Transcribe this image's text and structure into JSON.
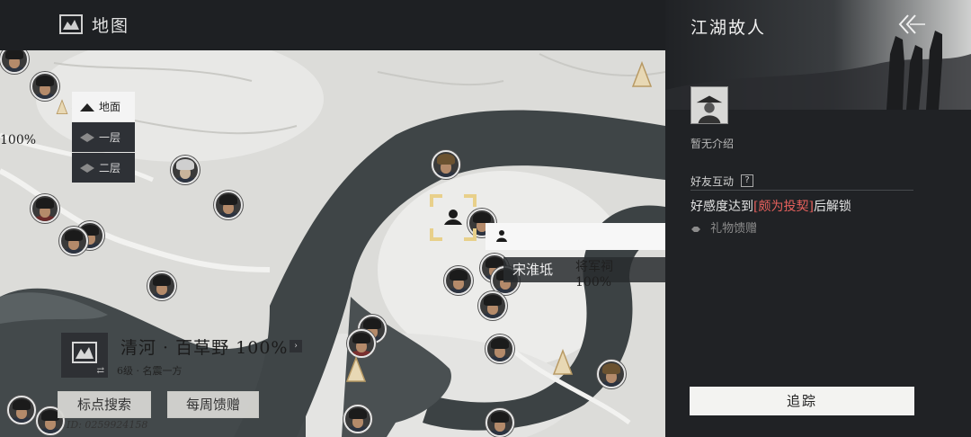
{
  "topbar": {
    "title": "地图",
    "map_icon": "map-icon"
  },
  "layers": [
    {
      "label": "地面",
      "active": true
    },
    {
      "label": "一层",
      "active": false
    },
    {
      "label": "二层",
      "active": false
    }
  ],
  "map": {
    "left_percent": "100%",
    "tooltip": {
      "npc_name": "宋淮坻",
      "location": "将军祠",
      "percent": "100%"
    }
  },
  "region": {
    "name": "清河 · 百草野 100%",
    "sub": "6级 · 名震一方",
    "search_button": "标点搜索",
    "weekly_button": "每周馈赠",
    "uid": "ID: 0259924158"
  },
  "panel": {
    "title": "江湖故人",
    "intro": "暂无介绍",
    "section_title": "好友互动",
    "unlock_prefix": "好感度达到",
    "unlock_highlight": "[颇为投契]",
    "unlock_suffix": "后解锁",
    "gift_label": "礼物馈赠",
    "track_button": "追踪"
  },
  "colors": {
    "highlight": "#e5605c",
    "panel_bg": "#202225",
    "map_bg": "#dcdcd9"
  }
}
